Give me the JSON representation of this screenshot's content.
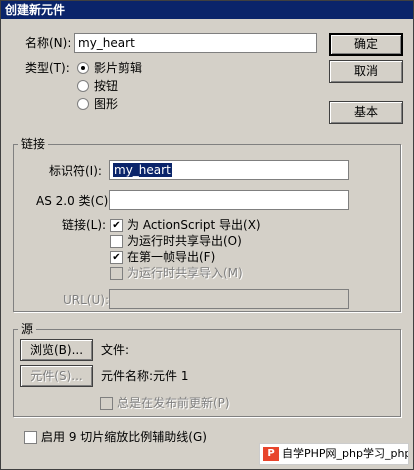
{
  "window": {
    "title": "创建新元件"
  },
  "name_field": {
    "label": "名称(N):",
    "value": "my_heart"
  },
  "type": {
    "label": "类型(T):",
    "options": [
      {
        "label": "影片剪辑",
        "selected": true
      },
      {
        "label": "按钮",
        "selected": false
      },
      {
        "label": "图形",
        "selected": false
      }
    ]
  },
  "buttons": {
    "ok": "确定",
    "cancel": "取消",
    "basic": "基本"
  },
  "linkage": {
    "group_title": "链接",
    "identifier_label": "标识符(I):",
    "identifier_value": "my_heart",
    "class_label": "AS 2.0 类(C):",
    "class_value": "",
    "linkage_label": "链接(L):",
    "options": [
      {
        "label": "为 ActionScript 导出(X)",
        "checked": true,
        "enabled": true
      },
      {
        "label": "为运行时共享导出(O)",
        "checked": false,
        "enabled": true
      },
      {
        "label": "在第一帧导出(F)",
        "checked": true,
        "enabled": true
      },
      {
        "label": "为运行时共享导入(M)",
        "checked": false,
        "enabled": false
      }
    ],
    "url_label": "URL(U):",
    "url_value": ""
  },
  "source": {
    "group_title": "源",
    "browse_button": "浏览(B)...",
    "file_label": "文件:",
    "symbol_button": "元件(S)...",
    "symbol_name": "元件名称:元件 1",
    "always_update": "总是在发布前更新(P)"
  },
  "scale_guides": {
    "label": "启用 9 切片缩放比例辅助线(G)",
    "checked": false
  },
  "watermark": {
    "logo": "P",
    "text": "自学PHP网_php学习_php教程"
  }
}
